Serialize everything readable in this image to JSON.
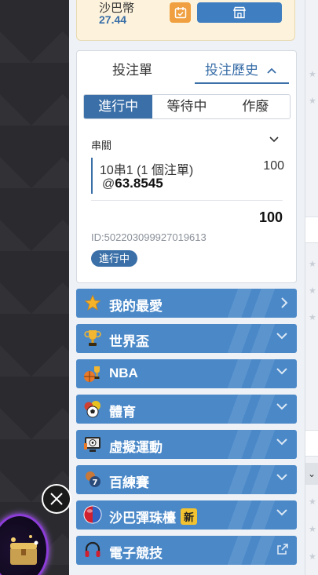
{
  "balance": {
    "currency": "沙巴幣",
    "amount": "27.44",
    "calendar_icon": "calendar-icon",
    "store_icon": "store-icon"
  },
  "tabs": {
    "bet_slip": "投注單",
    "bet_history": "投注歷史"
  },
  "status_tabs": [
    "進行中",
    "等待中",
    "作廢"
  ],
  "bet": {
    "type": "串關",
    "leg_desc": "10串1 (1 個注單)",
    "leg_stake": "100",
    "odds_prefix": "@",
    "odds": "63.8545",
    "total": "100",
    "id": "ID:502203099927019613",
    "status": "進行中"
  },
  "categories": [
    {
      "label": "我的最愛",
      "icon": "star-icon"
    },
    {
      "label": "世界盃",
      "icon": "trophy-icon"
    },
    {
      "label": "NBA",
      "icon": "nba-icon"
    },
    {
      "label": "體育",
      "icon": "sports-balls-icon"
    },
    {
      "label": "虛擬運動",
      "icon": "virtual-sports-icon"
    },
    {
      "label": "百練賽",
      "icon": "number-game-icon"
    },
    {
      "label": "沙巴彈珠檯",
      "icon": "pinball-icon",
      "badge": "新"
    },
    {
      "label": "電子競技",
      "icon": "headset-icon"
    }
  ],
  "colors": {
    "accent": "#3a6fa8",
    "category_bg": "#4a88c8",
    "badge": "#f2c230",
    "balance_bg": "#fdf3dc"
  }
}
